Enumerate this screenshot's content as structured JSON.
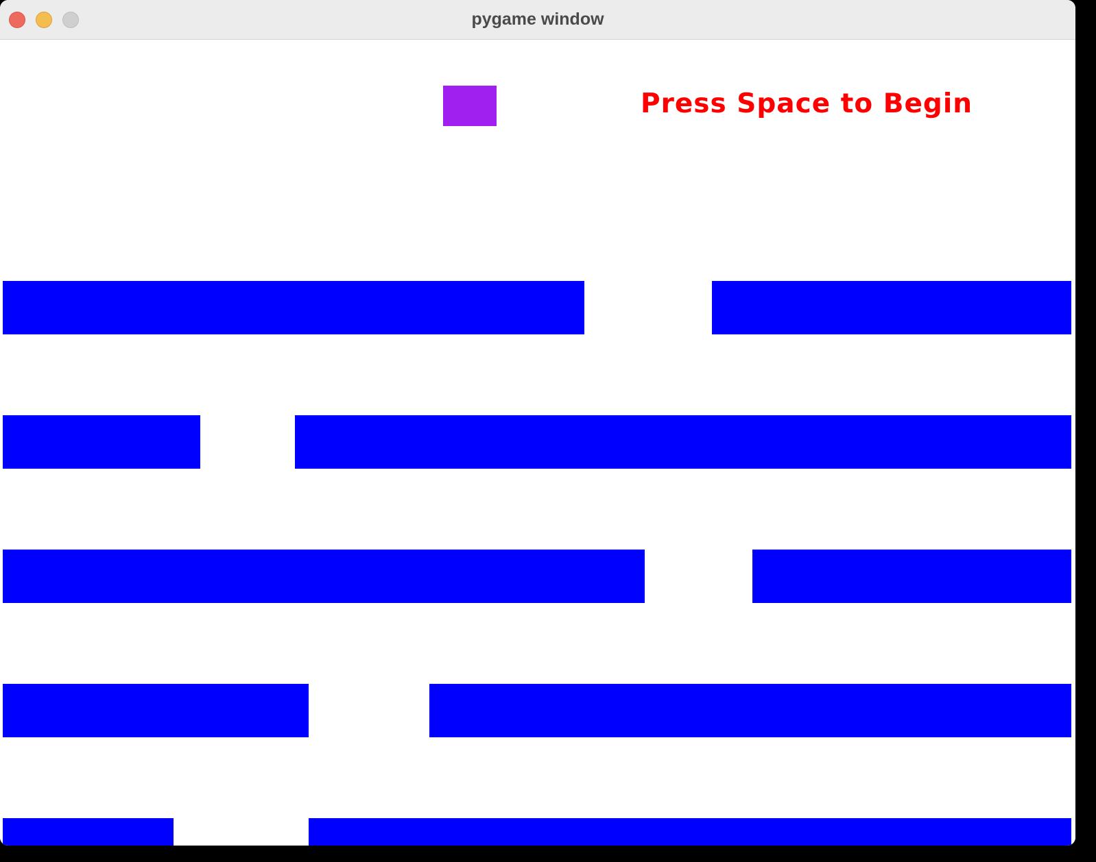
{
  "window": {
    "title": "pygame window",
    "traffic_lights": {
      "close_color": "#ee6a5f",
      "minimize_color": "#f5bd4f",
      "zoom_color": "#cfcfcf"
    }
  },
  "game": {
    "background_color": "#ffffff",
    "prompt_text": "Press Space to Begin",
    "prompt_color": "#ff0000",
    "player_color": "#a020f0",
    "platform_color": "#0000ff"
  }
}
